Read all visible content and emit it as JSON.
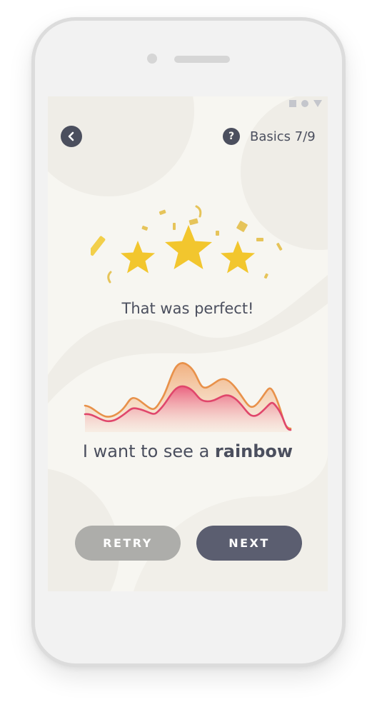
{
  "header": {
    "back_icon": "chevron-left-icon",
    "help_icon": "question-mark-icon",
    "help_glyph": "?",
    "progress_label": "Basics 7/9"
  },
  "status_bar": {
    "icons": [
      "square-icon",
      "circle-icon",
      "triangle-icon"
    ]
  },
  "result": {
    "stars_earned": 3,
    "stars_total": 3,
    "message": "That was perfect!"
  },
  "phrase": {
    "prefix": "I want to see a ",
    "highlight": "rainbow"
  },
  "buttons": {
    "retry_label": "RETRY",
    "next_label": "NEXT"
  },
  "colors": {
    "star": "#f2c62e",
    "confetti": "#e6c45a",
    "wave_orange": "#e8914a",
    "wave_pink": "#e0466b",
    "text_dark": "#4b4f5e",
    "retry_bg": "#adadaa",
    "next_bg": "#5b5e70",
    "screen_bg": "#f7f6f1"
  }
}
